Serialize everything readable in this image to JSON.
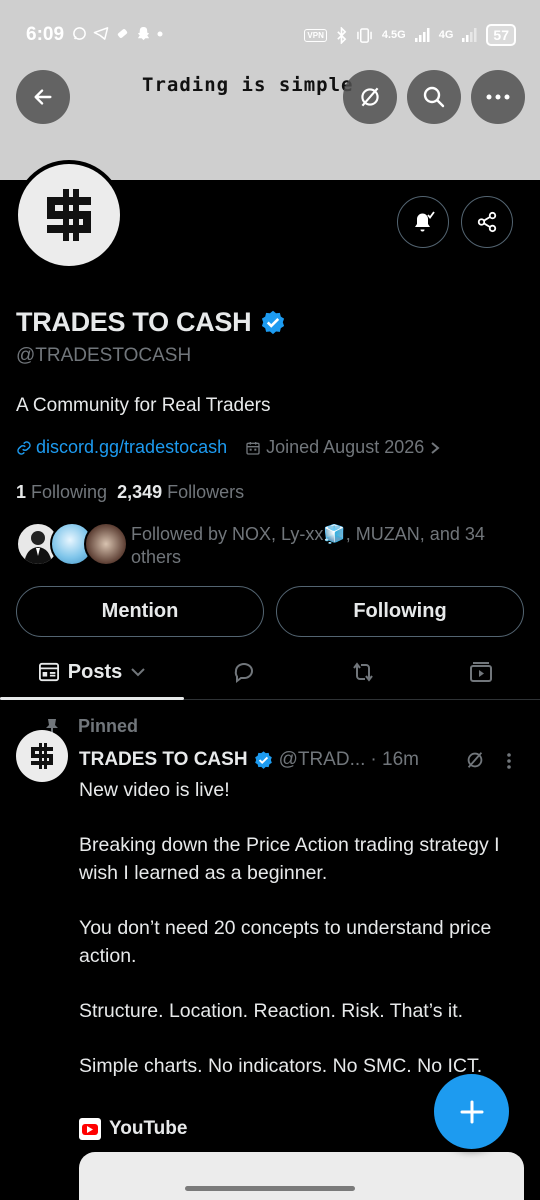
{
  "status_bar": {
    "time": "6:09",
    "battery": "57",
    "network_a": "4.5G",
    "network_b": "4G"
  },
  "banner": {
    "text": "Trading is simple"
  },
  "profile": {
    "name": "TRADES TO CASH",
    "handle": "@TRADESTOCASH",
    "bio": "A Community for Real Traders",
    "link": "discord.gg/tradestocash",
    "joined": "Joined August 2026",
    "following_count": "1",
    "following_label": "Following",
    "followers_count": "2,349",
    "followers_label": "Followers",
    "followed_by": "Followed by NOX, Ly-xx🧊, MUZAN, and 34 others",
    "avatar_symbol": "$"
  },
  "actions": {
    "mention": "Mention",
    "following": "Following"
  },
  "tabs": {
    "posts": "Posts"
  },
  "post": {
    "pinned_label": "Pinned",
    "author": "TRADES TO CASH",
    "handle": "@TRAD...",
    "time": "· 16m",
    "paragraphs": [
      "New video is live!",
      "Breaking down the Price Action trading strategy I wish I learned as a beginner.",
      "You don’t need 20 concepts to understand price action.",
      "Structure. Location. Reaction. Risk. That’s it.",
      "Simple charts. No indicators. No SMC. No ICT."
    ],
    "source": "YouTube"
  },
  "colors": {
    "accent": "#1d9bf0",
    "text": "#e7e9ea",
    "muted": "#71767b",
    "border": "#2f3336"
  }
}
